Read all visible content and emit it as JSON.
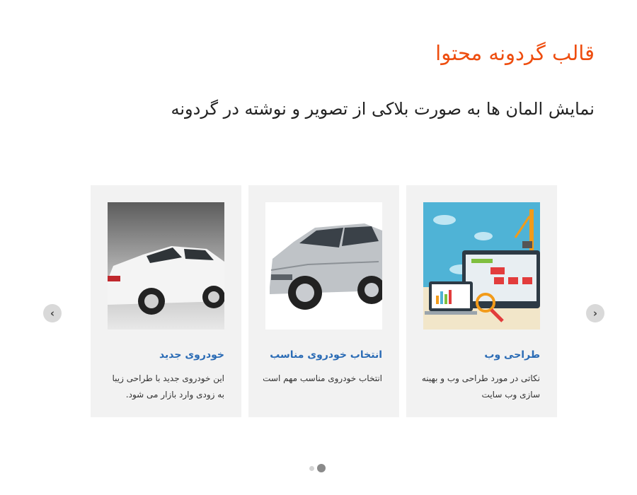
{
  "header": {
    "title": "قالب گردونه محتوا",
    "subtitle": "نمایش المان ها به صورت بلاکی از تصویر و نوشته در گردونه"
  },
  "carousel": {
    "cards": [
      {
        "title": "طراحی وب",
        "text": "نکاتی در مورد طراحی وب و بهینه سازی وب سایت",
        "image": "web-design-illustration"
      },
      {
        "title": "انتخاب خودروی مناسب",
        "text": "انتخاب خودروی مناسب مهم است",
        "image": "silver-suv-photo"
      },
      {
        "title": "خودروی جدید",
        "text": "این خودروی جدید با طراحی زیبا به زودی وارد بازار می شود.",
        "image": "white-sedan-photo"
      }
    ],
    "prev_icon": "chevron-left-icon",
    "next_icon": "chevron-right-icon",
    "pagination": {
      "pages": 2,
      "active": 2
    }
  },
  "colors": {
    "title": "#ee4d0f",
    "card_title": "#2a6bb5",
    "card_bg": "#f2f2f2"
  }
}
